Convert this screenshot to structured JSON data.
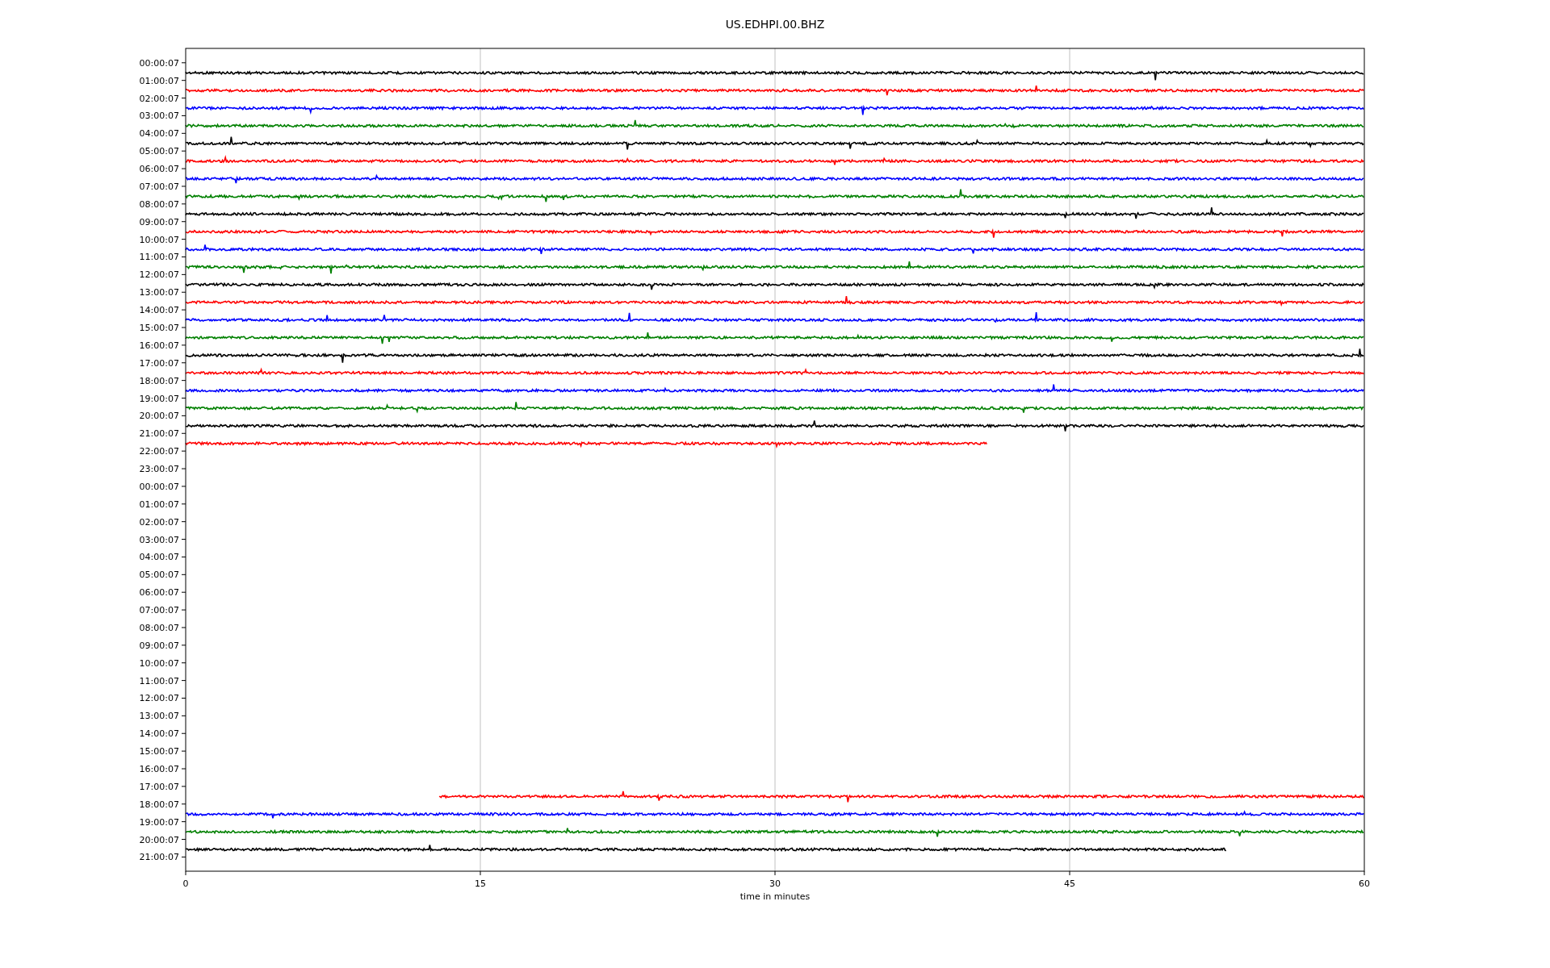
{
  "title": "US.EDHPI.00.BHZ",
  "xlabel": "time in minutes",
  "xticks": [
    "0",
    "15",
    "30",
    "45",
    "60"
  ],
  "rows": [
    {
      "label": "00:00:07",
      "trace": {
        "kind": "head",
        "color": "#000000",
        "level": 1
      }
    },
    {
      "label": "01:00:07",
      "trace": {
        "kind": "head",
        "color": "#ff0000",
        "level": 1
      }
    },
    {
      "label": "02:00:07",
      "trace": {
        "kind": "head",
        "color": "#0000ff",
        "level": 1
      }
    },
    {
      "label": "03:00:07",
      "trace": {
        "kind": "head",
        "color": "#008000",
        "level": 1
      }
    },
    {
      "label": "04:00:07",
      "trace": {
        "kind": "head",
        "color": "#000000",
        "level": 1
      }
    },
    {
      "label": "05:00:07",
      "trace": {
        "kind": "head",
        "color": "#ff0000",
        "level": 1
      }
    },
    {
      "label": "06:00:07",
      "trace": {
        "kind": "head",
        "color": "#0000ff",
        "level": 1
      }
    },
    {
      "label": "07:00:07",
      "trace": {
        "kind": "head",
        "color": "#008000",
        "level": 1
      }
    },
    {
      "label": "08:00:07",
      "trace": {
        "kind": "head",
        "color": "#000000",
        "level": 1
      }
    },
    {
      "label": "09:00:07",
      "trace": {
        "kind": "head",
        "color": "#ff0000",
        "level": 1
      }
    },
    {
      "label": "10:00:07",
      "trace": {
        "kind": "head",
        "color": "#0000ff",
        "level": 1
      }
    },
    {
      "label": "11:00:07",
      "trace": {
        "kind": "head",
        "color": "#008000",
        "level": 1
      }
    },
    {
      "label": "12:00:07",
      "trace": {
        "kind": "head",
        "color": "#000000",
        "level": 1
      }
    },
    {
      "label": "13:00:07",
      "trace": {
        "kind": "head",
        "color": "#ff0000",
        "level": 1
      }
    },
    {
      "label": "14:00:07",
      "trace": {
        "kind": "head",
        "color": "#0000ff",
        "level": 1
      }
    },
    {
      "label": "15:00:07",
      "trace": {
        "kind": "head",
        "color": "#008000",
        "level": 1
      }
    },
    {
      "label": "16:00:07",
      "trace": {
        "kind": "head",
        "color": "#000000",
        "level": 1
      }
    },
    {
      "label": "17:00:07",
      "trace": {
        "kind": "head",
        "color": "#ff0000",
        "level": 1
      }
    },
    {
      "label": "18:00:07",
      "trace": {
        "kind": "head",
        "color": "#0000ff",
        "level": 1
      }
    },
    {
      "label": "19:00:07",
      "trace": {
        "kind": "head",
        "color": "#008000",
        "level": 1
      }
    },
    {
      "label": "20:00:07",
      "trace": {
        "kind": "head",
        "color": "#000000",
        "level": 1
      }
    },
    {
      "label": "21:00:07",
      "trace": {
        "kind": "head",
        "color": "#ff0000",
        "level": 0.68
      }
    },
    {
      "label": "22:00:07"
    },
    {
      "label": "23:00:07"
    },
    {
      "label": "00:00:07"
    },
    {
      "label": "01:00:07"
    },
    {
      "label": "02:00:07"
    },
    {
      "label": "03:00:07"
    },
    {
      "label": "04:00:07"
    },
    {
      "label": "05:00:07"
    },
    {
      "label": "06:00:07"
    },
    {
      "label": "07:00:07"
    },
    {
      "label": "08:00:07"
    },
    {
      "label": "09:00:07"
    },
    {
      "label": "10:00:07"
    },
    {
      "label": "11:00:07"
    },
    {
      "label": "12:00:07"
    },
    {
      "label": "13:00:07"
    },
    {
      "label": "14:00:07"
    },
    {
      "label": "15:00:07"
    },
    {
      "label": "16:00:07"
    },
    {
      "label": "17:00:07",
      "trace": {
        "kind": "tail",
        "color": "#ff0000",
        "level": 0.785
      }
    },
    {
      "label": "18:00:07",
      "trace": {
        "kind": "head",
        "color": "#0000ff",
        "level": 1
      }
    },
    {
      "label": "19:00:07",
      "trace": {
        "kind": "head",
        "color": "#008000",
        "level": 1
      }
    },
    {
      "label": "20:00:07",
      "trace": {
        "kind": "head",
        "color": "#000000",
        "level": 0.883
      }
    },
    {
      "label": "21:00:07"
    }
  ]
}
